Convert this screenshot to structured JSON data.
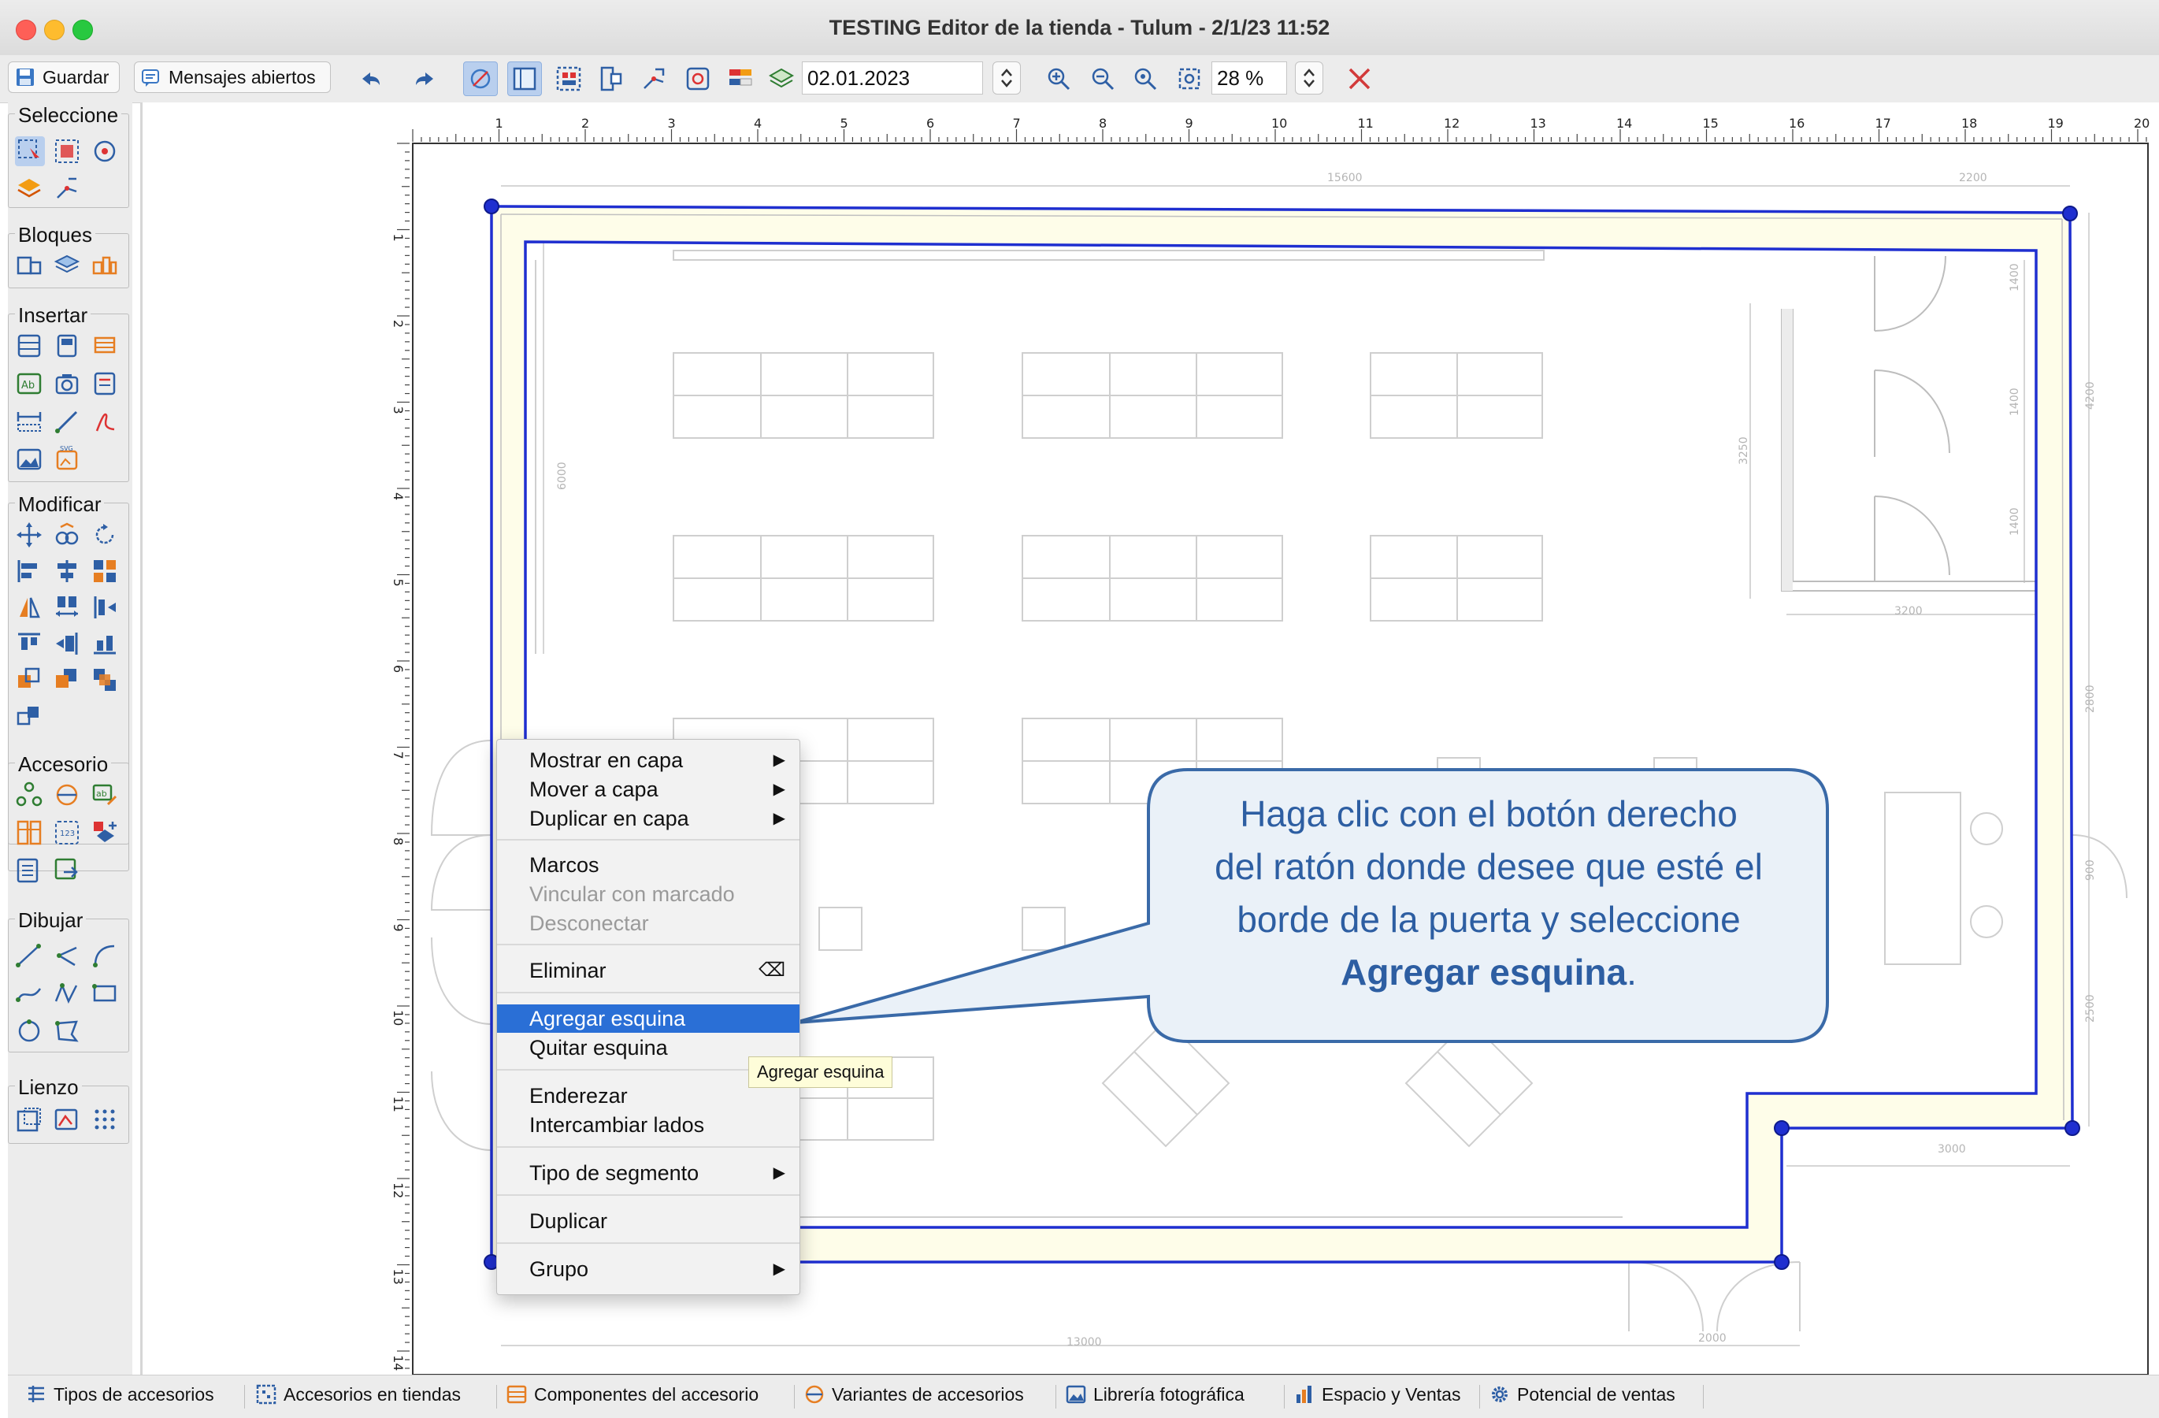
{
  "window": {
    "title": "TESTING Editor de la tienda - Tulum - 2/1/23 11:52"
  },
  "toolbar": {
    "save_label": "Guardar",
    "messages_label": "Mensajes abiertos",
    "date_value": "02.01.2023",
    "zoom_value": "28 %"
  },
  "palette": {
    "select": "Seleccione",
    "blocks": "Bloques",
    "insert": "Insertar",
    "modify": "Modificar",
    "fixture": "Accesorio",
    "draw": "Dibujar",
    "canvas": "Lienzo"
  },
  "ruler": {
    "top": [
      "1",
      "2",
      "3",
      "4",
      "5",
      "6",
      "7",
      "8",
      "9",
      "10",
      "11",
      "12",
      "13",
      "14",
      "15",
      "16",
      "17",
      "18",
      "19",
      "20"
    ],
    "left": [
      "1",
      "2",
      "3",
      "4",
      "5",
      "6",
      "7",
      "8",
      "9",
      "10",
      "11",
      "12",
      "13",
      "14"
    ]
  },
  "dimensions": {
    "top_main": "15600",
    "top_right": "2200",
    "bottom_main": "13000",
    "bottom_right": "2000",
    "room_width": "3200",
    "room_height": "3250",
    "step_width": "3000",
    "right_1": "4200",
    "right_2": "2800",
    "right_3": "900",
    "right_4": "2500",
    "inner_1": "1400",
    "inner_2": "1400",
    "inner_3": "1400",
    "left_vertical": "6000"
  },
  "context_menu": {
    "items": [
      {
        "label": "Mostrar en capa",
        "submenu": true
      },
      {
        "label": "Mover a capa",
        "submenu": true
      },
      {
        "label": "Duplicar en capa",
        "submenu": true
      },
      {
        "label": "Marcos"
      },
      {
        "label": "Vincular con marcado",
        "disabled": true
      },
      {
        "label": "Desconectar",
        "disabled": true
      },
      {
        "label": "Eliminar",
        "shortcut": "⌫"
      },
      {
        "label": "Agregar esquina",
        "selected": true
      },
      {
        "label": "Quitar esquina"
      },
      {
        "label": "Enderezar"
      },
      {
        "label": "Intercambiar lados"
      },
      {
        "label": "Tipo de segmento",
        "submenu": true
      },
      {
        "label": "Duplicar"
      },
      {
        "label": "Grupo",
        "submenu": true
      }
    ],
    "submenu_arrow": "▶"
  },
  "tooltip": "Agregar esquina",
  "callout": {
    "line1": "Haga clic con el botón derecho",
    "line2": "del ratón donde desee que esté el",
    "line3": "borde de la puerta y seleccione",
    "bold": "Agregar esquina",
    "end": "."
  },
  "bottom_tabs": [
    "Tipos de accesorios",
    "Accesorios en tiendas",
    "Componentes del accesorio",
    "Variantes de accesorios",
    "Librería fotográfica",
    "Espacio y Ventas",
    "Potencial de ventas"
  ],
  "colors": {
    "wall_outline": "#1f2fd0",
    "wall_fill": "#fefde9",
    "callout_border": "#3a6aa8",
    "callout_fill": "#eaf1f8",
    "menu_highlight": "#2a6fd6",
    "close_x": "#d23a3a"
  }
}
